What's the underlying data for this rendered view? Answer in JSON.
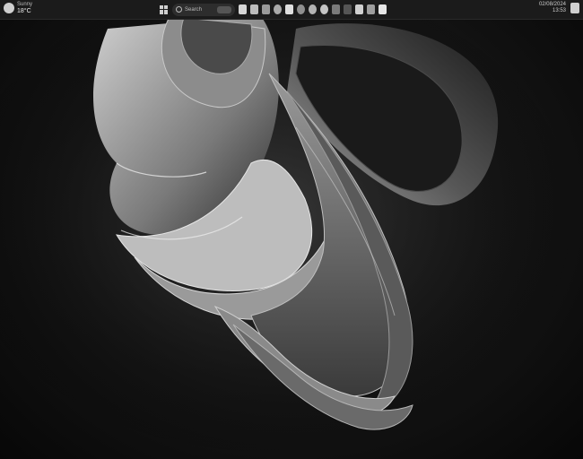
{
  "taskbar": {
    "weather": {
      "condition": "Sunny",
      "temperature": "18°C"
    },
    "search": {
      "placeholder": "Search"
    },
    "clock": {
      "date": "02/08/2024",
      "time": "13:53"
    },
    "pinned_apps": [
      "file-explorer-icon",
      "store-icon",
      "mail-icon",
      "edge-icon",
      "chrome-icon",
      "teams-icon",
      "spotify-icon",
      "settings-icon",
      "vscode-icon",
      "photos-icon",
      "word-icon",
      "excel-icon",
      "terminal-icon"
    ]
  },
  "colors": {
    "taskbar_bg": "#1b1b1b",
    "wallpaper_dark": "#070707",
    "wallpaper_light": "#c9c9c9"
  }
}
